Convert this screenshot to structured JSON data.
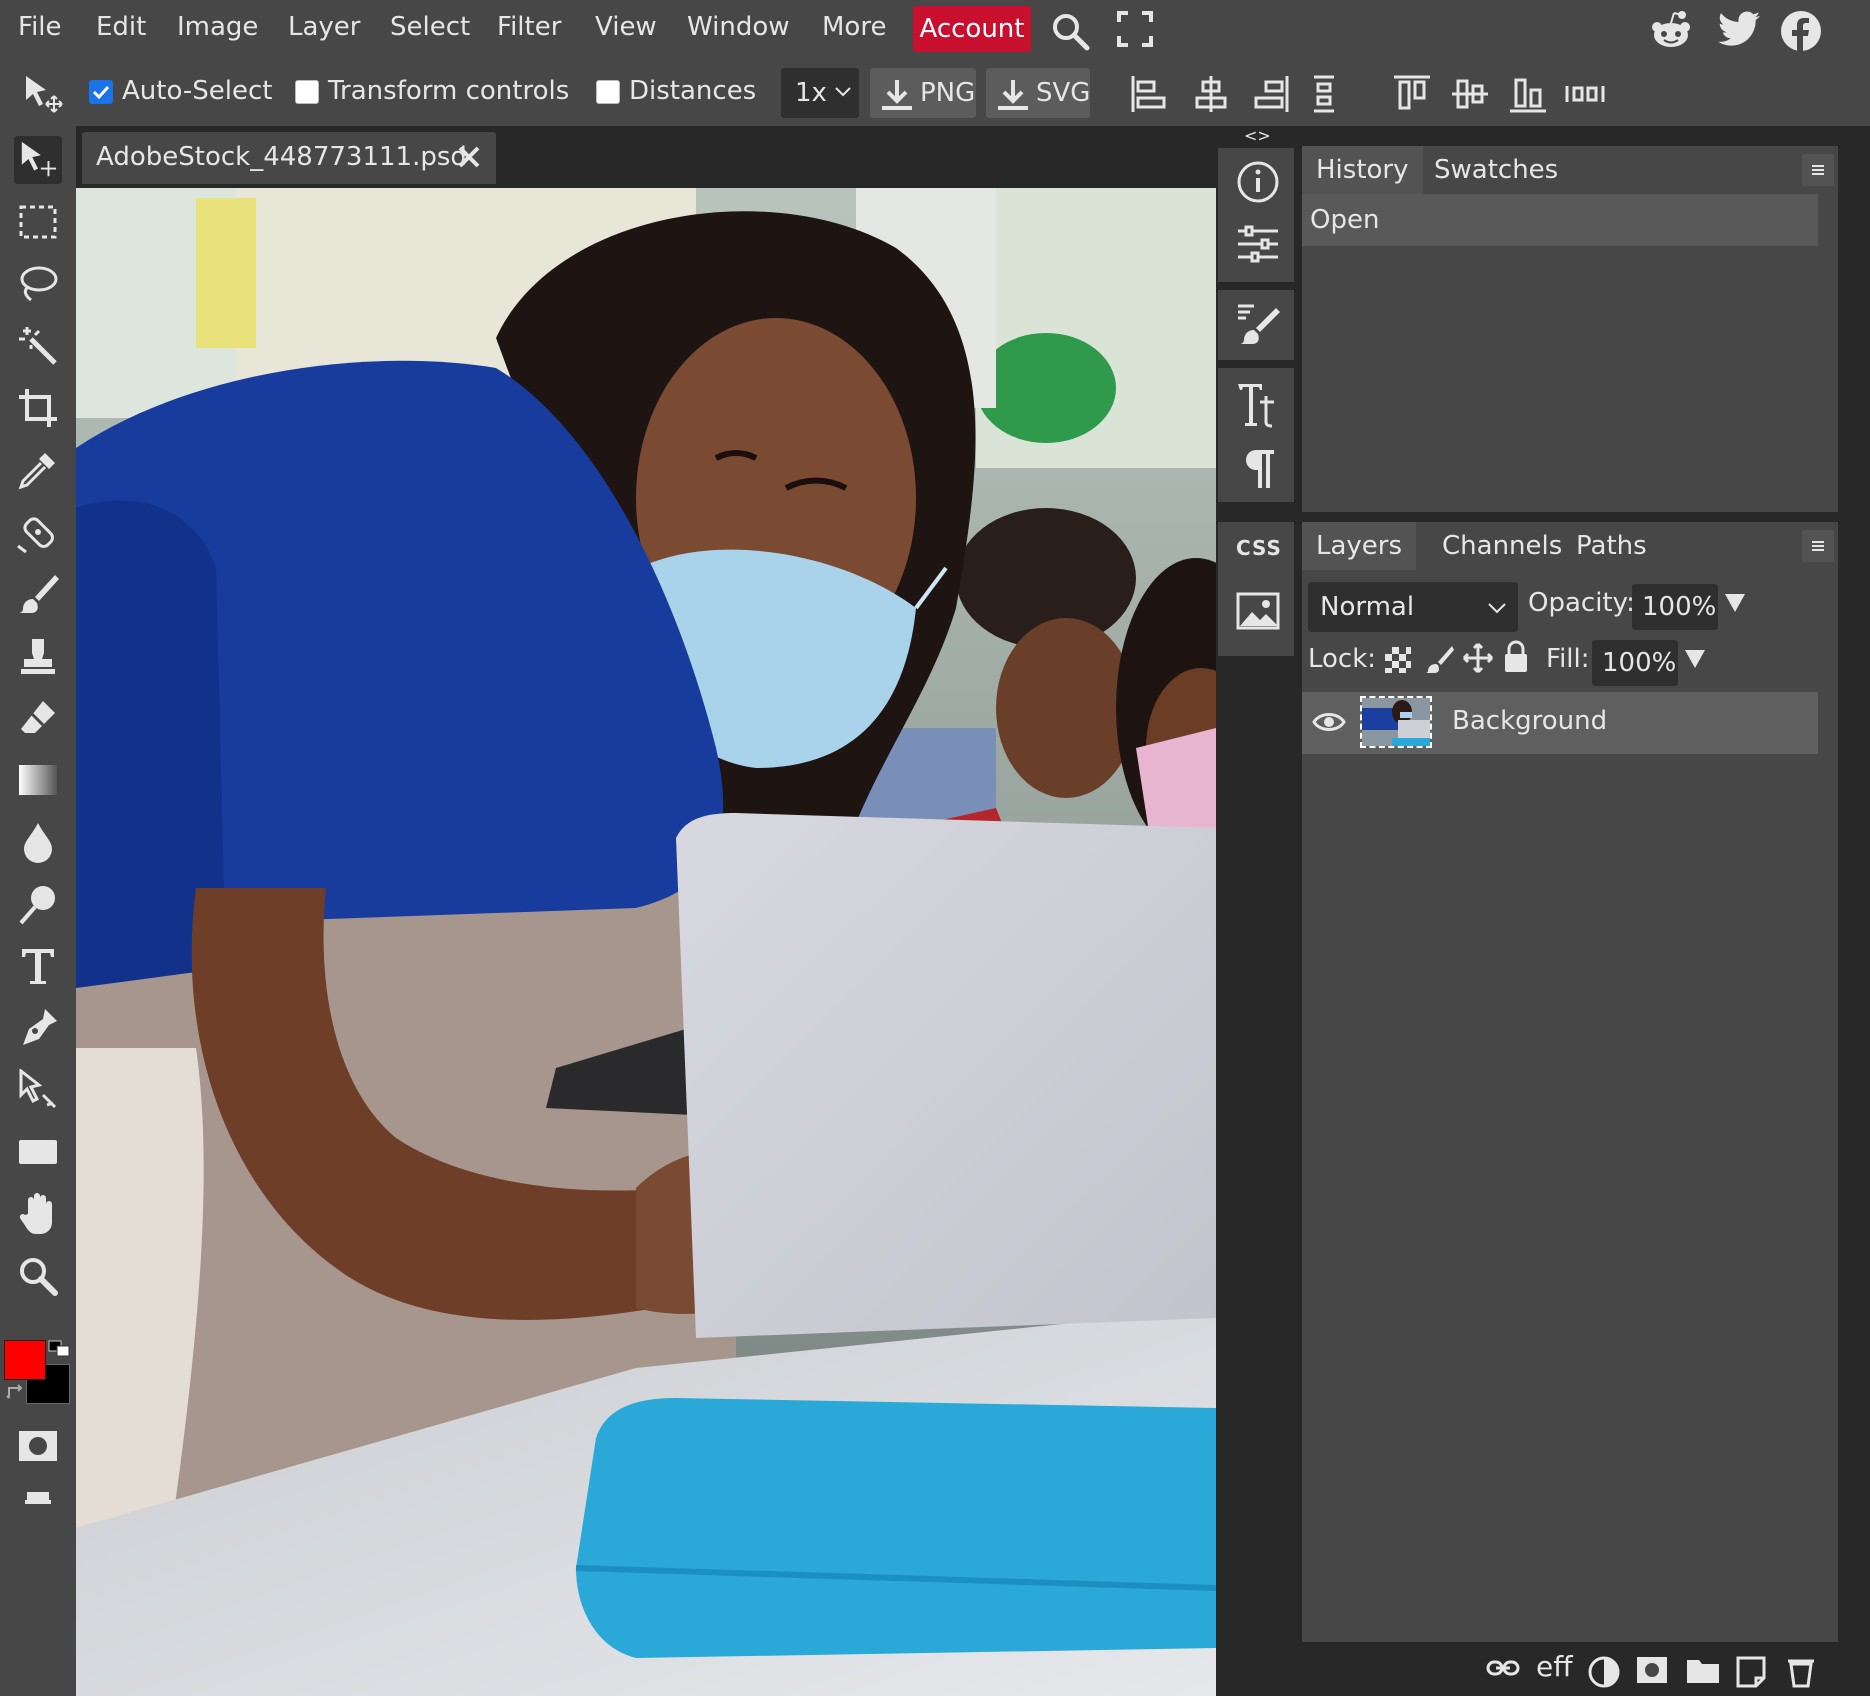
{
  "menubar": {
    "items": [
      "File",
      "Edit",
      "Image",
      "Layer",
      "Select",
      "Filter",
      "View",
      "Window",
      "More"
    ],
    "account_label": "Account",
    "icons": [
      "search-icon",
      "fullscreen-icon",
      "reddit-icon",
      "twitter-icon",
      "facebook-icon"
    ]
  },
  "options": {
    "auto_select_label": "Auto-Select",
    "auto_select_checked": true,
    "transform_controls_label": "Transform controls",
    "transform_controls_checked": false,
    "distances_label": "Distances",
    "distances_checked": false,
    "zoom_value": "1x",
    "png_label": "PNG",
    "svg_label": "SVG"
  },
  "document": {
    "tab_title": "AdobeStock_448773111.psd"
  },
  "panels": {
    "collapse_left": "<>",
    "collapse_right": "><",
    "top_tabs": [
      "History",
      "Swatches"
    ],
    "history_items": [
      "Open"
    ],
    "bottom_tabs": [
      "Layers",
      "Channels",
      "Paths"
    ],
    "blend_mode": "Normal",
    "opacity_label": "Opacity:",
    "opacity_value": "100%",
    "lock_label": "Lock:",
    "fill_label": "Fill:",
    "fill_value": "100%",
    "layers": [
      {
        "name": "Background",
        "visible": true
      }
    ],
    "mini_css_label": "CSS"
  },
  "colors": {
    "foreground": "#ff0000",
    "background": "#000000",
    "accent": "#c8102e"
  }
}
